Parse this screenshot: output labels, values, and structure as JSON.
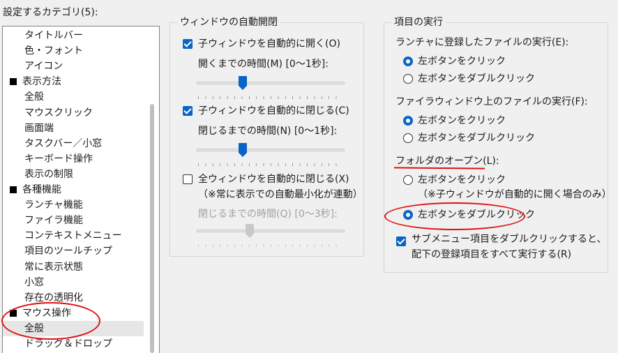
{
  "categories": {
    "label": "設定するカテゴリ(5):",
    "items": [
      {
        "label": "タイトルバー",
        "level": 1
      },
      {
        "label": "色・フォント",
        "level": 1
      },
      {
        "label": "アイコン",
        "level": 1
      },
      {
        "label": "表示方法",
        "level": 0
      },
      {
        "label": "全般",
        "level": 1
      },
      {
        "label": "マウスクリック",
        "level": 1
      },
      {
        "label": "画面端",
        "level": 1
      },
      {
        "label": "タスクバー／小窓",
        "level": 1
      },
      {
        "label": "キーボード操作",
        "level": 1
      },
      {
        "label": "表示の制限",
        "level": 1
      },
      {
        "label": "各種機能",
        "level": 0
      },
      {
        "label": "ランチャ機能",
        "level": 1
      },
      {
        "label": "ファイラ機能",
        "level": 1
      },
      {
        "label": "コンテキストメニュー",
        "level": 1
      },
      {
        "label": "項目のツールチップ",
        "level": 1
      },
      {
        "label": "常に表示状態",
        "level": 1
      },
      {
        "label": "小窓",
        "level": 1
      },
      {
        "label": "存在の透明化",
        "level": 1
      },
      {
        "label": "マウス操作",
        "level": 0
      },
      {
        "label": "全般",
        "level": 1,
        "selected": true
      },
      {
        "label": "ドラッグ＆ドロップ",
        "level": 1
      }
    ]
  },
  "auto_open": {
    "title": "ウィンドウの自動開閉",
    "open_child": {
      "label": "子ウィンドウを自動的に開く(O)",
      "checked": true
    },
    "open_delay_label": "開くまでの時間(M) [0〜1秒]:",
    "open_delay_value": 0.3,
    "close_child": {
      "label": "子ウィンドウを自動的に閉じる(C)",
      "checked": true
    },
    "close_delay_label": "閉じるまでの時間(N) [0〜1秒]:",
    "close_delay_value": 0.3,
    "close_all": {
      "label": "全ウィンドウを自動的に閉じる(X)",
      "checked": false
    },
    "close_all_note": "（※常に表示での自動最小化が連動）",
    "close_all_delay_label": "閉じるまでの時間(Q) [0〜3秒]:",
    "close_all_delay_value": 0.35
  },
  "exec": {
    "title": "項目の実行",
    "launcher_label": "ランチャに登録したファイルの実行(E):",
    "launcher_options": [
      "左ボタンをクリック",
      "左ボタンをダブルクリック"
    ],
    "launcher_selected": 0,
    "filer_label": "ファイラウィンドウ上のファイルの実行(F):",
    "filer_options": [
      "左ボタンをクリック",
      "左ボタンをダブルクリック"
    ],
    "filer_selected": 0,
    "folder_label": "フォルダのオープン(L):",
    "folder_option_click": "左ボタンをクリック",
    "folder_option_click_note": "（※子ウィンドウが自動的に開く場合のみ）",
    "folder_option_dbl": "左ボタンをダブルクリック",
    "folder_selected": 1,
    "submenu_line1": "サブメニュー項目をダブルクリックすると、",
    "submenu_line2": "配下の登録項目をすべて実行する(R)",
    "submenu_checked": true
  },
  "colors": {
    "accent": "#0a64c8",
    "annotation": "#e01010"
  }
}
